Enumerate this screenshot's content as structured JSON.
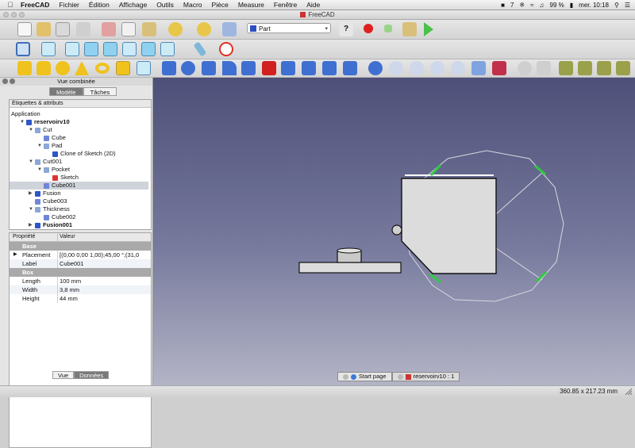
{
  "menubar": {
    "app_name": "FreeCAD",
    "items": [
      "Fichier",
      "Édition",
      "Affichage",
      "Outils",
      "Macro",
      "Pièce",
      "Measure",
      "Fenêtre",
      "Aide"
    ],
    "tray": {
      "notif": "7",
      "battery": "99 %",
      "clock": "mer. 10:18"
    }
  },
  "window": {
    "title": "FreeCAD"
  },
  "toolbar": {
    "workbench": "Part"
  },
  "panel": {
    "title": "Vue combinée",
    "tabs": [
      "Modèle",
      "Tâches"
    ],
    "tree_header": "Étiquettes & attributs",
    "tree": [
      {
        "label": "Application",
        "level": 0,
        "icon": "none",
        "bold": false
      },
      {
        "label": "reservoirv10",
        "level": 1,
        "icon": "document-icon",
        "bold": true,
        "expanded": true
      },
      {
        "label": "Cut",
        "level": 2,
        "icon": "cut-icon",
        "bold": false,
        "expanded": true
      },
      {
        "label": "Cube",
        "level": 3,
        "icon": "cube-icon",
        "bold": false
      },
      {
        "label": "Pad",
        "level": 3,
        "icon": "pad-icon",
        "bold": false,
        "expanded": true
      },
      {
        "label": "Clone of Sketch (2D)",
        "level": 4,
        "icon": "clone-icon",
        "bold": false
      },
      {
        "label": "Cut001",
        "level": 2,
        "icon": "cut-icon",
        "bold": false,
        "expanded": true
      },
      {
        "label": "Pocket",
        "level": 3,
        "icon": "pocket-icon",
        "bold": false,
        "expanded": true
      },
      {
        "label": "Sketch",
        "level": 4,
        "icon": "sketch-icon",
        "bold": false
      },
      {
        "label": "Cube001",
        "level": 3,
        "icon": "cube-icon",
        "bold": false,
        "selected": true
      },
      {
        "label": "Fusion",
        "level": 2,
        "icon": "fusion-icon",
        "bold": false,
        "collapsed": true
      },
      {
        "label": "Cube003",
        "level": 2,
        "icon": "cube-icon",
        "bold": false
      },
      {
        "label": "Thickness",
        "level": 2,
        "icon": "thickness-icon",
        "bold": false,
        "expanded": true
      },
      {
        "label": "Cube002",
        "level": 3,
        "icon": "cube-icon",
        "bold": false
      },
      {
        "label": "Fusion001",
        "level": 2,
        "icon": "fusion-icon",
        "bold": true,
        "collapsed": true
      }
    ],
    "props": {
      "col_prop": "Propriété",
      "col_val": "Valeur",
      "groups": [
        {
          "name": "Base",
          "rows": [
            {
              "key": "Placement",
              "value": "[(0,00 0,00 1,00);45,00 °;(31,0",
              "expandable": true
            },
            {
              "key": "Label",
              "value": "Cube001"
            }
          ]
        },
        {
          "name": "Box",
          "rows": [
            {
              "key": "Length",
              "value": "100 mm"
            },
            {
              "key": "Width",
              "value": "3,8 mm"
            },
            {
              "key": "Height",
              "value": "44 mm"
            }
          ]
        }
      ]
    },
    "bottom_tabs": [
      "Vue",
      "Données"
    ]
  },
  "view": {
    "tabs": [
      "Start page",
      "reservoirv10 : 1"
    ],
    "colors": {
      "top": "#4d4f78",
      "bottom": "#b3b4c6",
      "selection": "#2ecc40"
    }
  },
  "status": {
    "dimensions": "360.85 x 217.23 mm"
  }
}
